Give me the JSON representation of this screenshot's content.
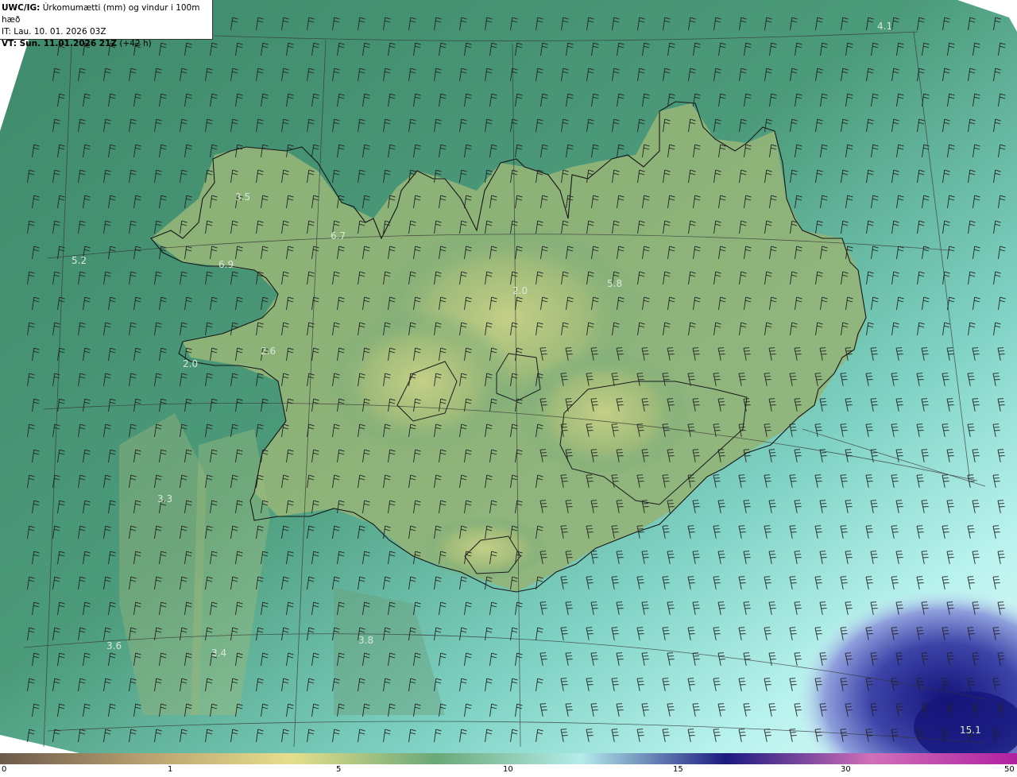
{
  "header": {
    "prefix": "UWC/IG:",
    "title": "Úrkomumætti (mm) og vindur i 100m hæð",
    "it": "IT: Lau. 10. 01. 2026 03Z",
    "vt_bold": "VT: Sun. 11.01.2026 21Z",
    "vt_extra": "(+42 h)"
  },
  "labels": [
    {
      "v": "4.1"
    },
    {
      "v": "3.5"
    },
    {
      "v": "6.7"
    },
    {
      "v": "5.2"
    },
    {
      "v": "6.9"
    },
    {
      "v": "2.0"
    },
    {
      "v": "5.8"
    },
    {
      "v": "2.6"
    },
    {
      "v": "2.0"
    },
    {
      "v": "3.3"
    },
    {
      "v": "3.6"
    },
    {
      "v": "3.4"
    },
    {
      "v": "3.8"
    },
    {
      "v": "15.1"
    }
  ],
  "colorbar": {
    "ticks": [
      "0",
      "1",
      "5",
      "10",
      "15",
      "30",
      "50"
    ],
    "colors": [
      "#6b5a4a",
      "#b9a070",
      "#e6df8c",
      "#6aa878",
      "#b4ecea",
      "#1c1a80",
      "#d070b8",
      "#b020a0"
    ]
  },
  "colors": {
    "sea_base": "#3f8f72",
    "land_base": "#8fb078",
    "high_precip": "#22287e",
    "frame": "#ffffff"
  }
}
